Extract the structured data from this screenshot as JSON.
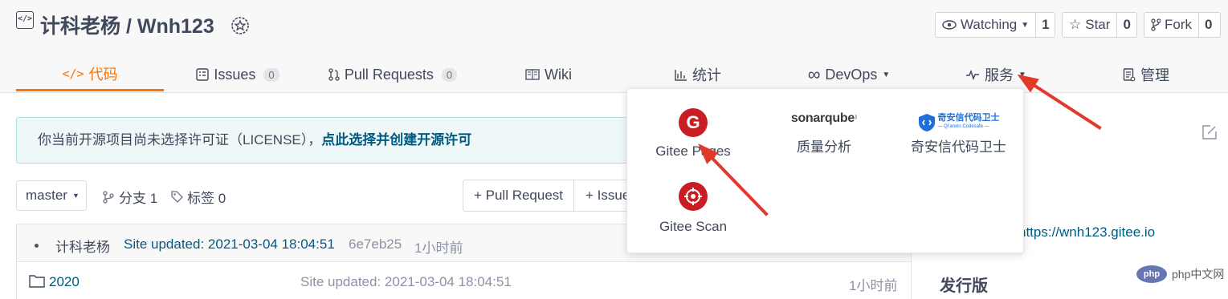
{
  "repo": {
    "owner": "计科老杨",
    "separator": "/",
    "name": "Wnh123"
  },
  "actions": {
    "watch_label": "Watching",
    "watch_count": "1",
    "star_label": "Star",
    "star_count": "0",
    "fork_label": "Fork",
    "fork_count": "0"
  },
  "tabs": [
    {
      "label": "代码",
      "icon": "code-icon"
    },
    {
      "label": "Issues",
      "count": "0",
      "icon": "issues-icon"
    },
    {
      "label": "Pull Requests",
      "count": "0",
      "icon": "pull-request-icon"
    },
    {
      "label": "Wiki",
      "icon": "wiki-icon"
    },
    {
      "label": "统计",
      "icon": "bar-chart-icon"
    },
    {
      "label": "DevOps",
      "icon": "infinity-icon"
    },
    {
      "label": "服务",
      "icon": "pulse-icon"
    },
    {
      "label": "管理",
      "icon": "manage-icon"
    }
  ],
  "notice": {
    "text": "你当前开源项目尚未选择许可证（LICENSE），",
    "link": "点此选择并创建开源许可"
  },
  "branch": {
    "name": "master",
    "branches": "分支 1",
    "tags": "标签 0"
  },
  "toolbar": {
    "pull_request": "+ Pull Request",
    "issue": "+ Issue"
  },
  "commit": {
    "author": "计科老杨",
    "message": "Site updated: 2021-03-04 18:04:51",
    "hash": "6e7eb25",
    "time": "1小时前"
  },
  "files": [
    {
      "name": "2020",
      "message": "Site updated: 2021-03-04 18:04:51",
      "time": "1小时前"
    }
  ],
  "services": [
    {
      "label": "Gitee Pages",
      "icon": "gitee-pages-icon"
    },
    {
      "label": "质量分析",
      "logo_text": "sonarqube",
      "icon": "sonarqube-logo"
    },
    {
      "label": "奇安信代码卫士",
      "logo_text": "奇安信代码卫士",
      "logo_sub": "— Qi'anxin Codesafe —",
      "icon": "qianxin-logo"
    },
    {
      "label": "Gitee Scan",
      "icon": "gitee-scan-icon"
    }
  ],
  "sidebar": {
    "website": "https://wnh123.gitee.io",
    "releases_title": "发行版"
  },
  "watermark": "php中文网",
  "colors": {
    "accent": "#fe7300",
    "link": "#005980",
    "brand_red": "#c71d23",
    "arrow": "#e23a2a"
  }
}
